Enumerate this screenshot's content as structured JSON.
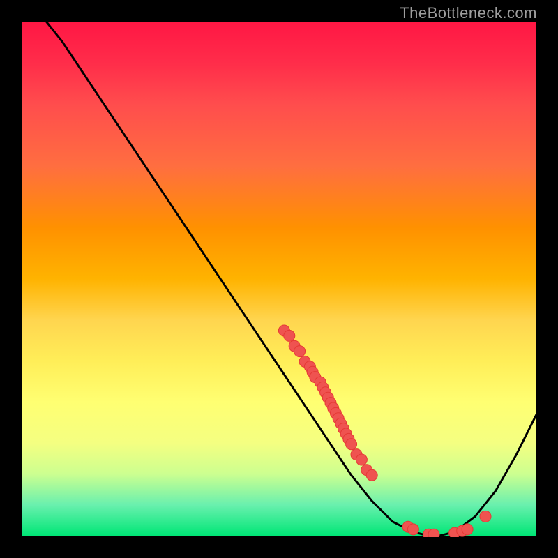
{
  "watermark": "TheBottleneck.com",
  "chart_data": {
    "type": "line",
    "title": "",
    "xlabel": "",
    "ylabel": "",
    "xlim": [
      0,
      100
    ],
    "ylim": [
      0,
      100
    ],
    "curve": {
      "name": "bottleneck-curve",
      "x": [
        0,
        4,
        8,
        12,
        16,
        20,
        24,
        28,
        32,
        36,
        40,
        44,
        48,
        52,
        56,
        60,
        64,
        68,
        72,
        76,
        80,
        84,
        88,
        92,
        96,
        100
      ],
      "y": [
        105,
        101,
        96,
        90,
        84,
        78,
        72,
        66,
        60,
        54,
        48,
        42,
        36,
        30,
        24,
        18,
        12,
        7,
        3,
        1,
        0,
        1,
        4,
        9,
        16,
        24
      ]
    },
    "markers": {
      "name": "data-points",
      "points": [
        {
          "x": 51,
          "y": 40
        },
        {
          "x": 52,
          "y": 39
        },
        {
          "x": 53,
          "y": 37
        },
        {
          "x": 54,
          "y": 36
        },
        {
          "x": 55,
          "y": 34
        },
        {
          "x": 56,
          "y": 33
        },
        {
          "x": 56.5,
          "y": 32
        },
        {
          "x": 57,
          "y": 31
        },
        {
          "x": 58,
          "y": 30
        },
        {
          "x": 58.5,
          "y": 29
        },
        {
          "x": 59,
          "y": 28
        },
        {
          "x": 59.5,
          "y": 27
        },
        {
          "x": 60,
          "y": 26
        },
        {
          "x": 60.5,
          "y": 25
        },
        {
          "x": 61,
          "y": 24
        },
        {
          "x": 61.5,
          "y": 23
        },
        {
          "x": 62,
          "y": 22
        },
        {
          "x": 62.5,
          "y": 21
        },
        {
          "x": 63,
          "y": 20
        },
        {
          "x": 63.5,
          "y": 19
        },
        {
          "x": 64,
          "y": 18
        },
        {
          "x": 65,
          "y": 16
        },
        {
          "x": 66,
          "y": 15
        },
        {
          "x": 67,
          "y": 13
        },
        {
          "x": 68,
          "y": 12
        },
        {
          "x": 75,
          "y": 2
        },
        {
          "x": 76,
          "y": 1.5
        },
        {
          "x": 79,
          "y": 0.5
        },
        {
          "x": 80,
          "y": 0.5
        },
        {
          "x": 84,
          "y": 0.8
        },
        {
          "x": 85.5,
          "y": 1.2
        },
        {
          "x": 86.5,
          "y": 1.5
        },
        {
          "x": 90,
          "y": 4
        }
      ]
    },
    "colors": {
      "gradient_top": "#ff1744",
      "gradient_bottom": "#00e676",
      "curve": "#000000",
      "marker_fill": "#ef5350",
      "marker_stroke": "#e53935",
      "background": "#000000"
    }
  }
}
